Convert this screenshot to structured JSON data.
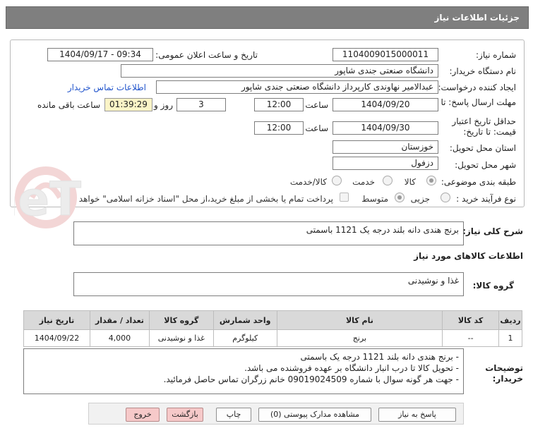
{
  "header": {
    "title": "جزئیات اطلاعات نیاز"
  },
  "fields": {
    "need_number_label": "شماره نیاز:",
    "need_number": "1104009015000011",
    "announce_label": "تاریخ و ساعت اعلان عمومی:",
    "announce_value": "1404/09/17 - 09:34",
    "buyer_org_label": "نام دستگاه خریدار:",
    "buyer_org": "دانشگاه صنعتی جندی شاپور",
    "creator_label": "ایجاد کننده درخواست:",
    "creator": "عبدالامیر نهاوندی کارپرداز دانشگاه صنعتی جندی شاپور",
    "contact_link": "اطلاعات تماس خریدار",
    "reply_deadline_label": "مهلت ارسال پاسخ: تا تاریخ:",
    "reply_date": "1404/09/20",
    "time_label": "ساعت",
    "reply_time": "12:00",
    "days_value": "3",
    "days_label": "روز و",
    "remaining_time": "01:39:29",
    "remaining_label": "ساعت باقی مانده",
    "validity_label_1": "حداقل تاریخ اعتبار",
    "validity_label_2": "قیمت: تا تاریخ:",
    "validity_date": "1404/09/30",
    "validity_time": "12:00",
    "province_label": "استان محل تحویل:",
    "province": "خوزستان",
    "city_label": "شهر محل تحویل:",
    "city": "دزفول",
    "category_label": "طبقه بندی موضوعی:",
    "category_options": [
      "کالا",
      "خدمت",
      "کالا/خدمت"
    ],
    "process_label": "نوع فرآیند خرید :",
    "process_options": [
      "جزیی",
      "متوسط"
    ],
    "payment_note": "پرداخت تمام یا بخشی از مبلغ خرید،از محل \"اسناد خزانه اسلامی\" خواهد بود."
  },
  "description": {
    "label": "شرح کلی نیاز:",
    "value": "برنج هندی دانه بلند درجه یک 1121 باسمتی"
  },
  "goods_info": {
    "title": "اطلاعات کالاهای مورد نیاز",
    "group_label": "گروه کالا:",
    "group_value": "غذا و نوشیدنی"
  },
  "table": {
    "headers": [
      "ردیف",
      "کد کالا",
      "نام کالا",
      "واحد شمارش",
      "گروه کالا",
      "تعداد / مقدار",
      "تاریخ نیاز"
    ],
    "rows": [
      [
        "1",
        "--",
        "برنج",
        "کیلوگرم",
        "غذا و نوشیدنی",
        "4,000",
        "1404/09/22"
      ]
    ]
  },
  "buyer_notes": {
    "label_1": "توضیحات",
    "label_2": "خریدار:",
    "lines": [
      "- برنج هندی دانه بلند 1121 درجه یک باسمتی",
      "- تحویل کالا تا درب انبار دانشگاه بر عهده فروشنده می باشد.",
      "- جهت هر گونه سوال با شماره 09019024509 خانم زرگران تماس حاصل فرمائید."
    ]
  },
  "buttons": {
    "reply": "پاسخ به نیاز",
    "attachments": "مشاهده مدارک پیوستی (0)",
    "print": "چاپ",
    "back": "بازگشت",
    "exit": "خروج"
  },
  "watermark": {
    "text": "AriaTender.neT"
  },
  "colors": {
    "title_bar": "#7f7f7f",
    "timer_bg": "#fbf4c7",
    "link": "#2255cc",
    "danger_button": "#f6c9c9"
  }
}
